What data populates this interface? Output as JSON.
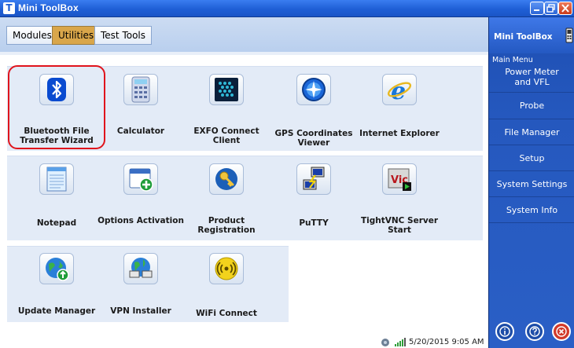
{
  "window": {
    "title": "Mini ToolBox",
    "logo_letter": "T"
  },
  "tabs": [
    {
      "label": "Modules",
      "active": false
    },
    {
      "label": "Utilities",
      "active": true
    },
    {
      "label": "Test Tools",
      "active": false
    }
  ],
  "apps": {
    "row1": [
      {
        "label": "Bluetooth File Transfer Wizard",
        "icon": "bluetooth-icon",
        "selected": true
      },
      {
        "label": "Calculator",
        "icon": "calculator-icon"
      },
      {
        "label": "EXFO Connect Client",
        "icon": "exfo-connect-icon"
      },
      {
        "label": "GPS Coordinates Viewer",
        "icon": "gps-compass-icon"
      },
      {
        "label": "Internet Explorer",
        "icon": "internet-explorer-icon"
      }
    ],
    "row2": [
      {
        "label": "Notepad",
        "icon": "notepad-icon"
      },
      {
        "label": "Options Activation",
        "icon": "options-activation-icon"
      },
      {
        "label": "Product Registration",
        "icon": "key-icon"
      },
      {
        "label": "PuTTY",
        "icon": "putty-icon"
      },
      {
        "label": "TightVNC Server Start",
        "icon": "tightvnc-icon"
      }
    ],
    "row3": [
      {
        "label": "Update Manager",
        "icon": "globe-update-icon"
      },
      {
        "label": "VPN Installer",
        "icon": "vpn-globe-icon"
      },
      {
        "label": "WiFi Connect",
        "icon": "wifi-icon"
      }
    ]
  },
  "app_labels": {
    "bluetooth_l1": "Bluetooth File",
    "bluetooth_l2": "Transfer Wizard",
    "calculator": "Calculator",
    "exfo": "EXFO Connect Client",
    "gps_l1": "GPS Coordinates",
    "gps_l2": "Viewer",
    "ie": "Internet Explorer",
    "notepad": "Notepad",
    "options": "Options Activation",
    "product_l1": "Product",
    "product_l2": "Registration",
    "putty": "PuTTY",
    "tightvnc_l1": "TightVNC Server",
    "tightvnc_l2": "Start",
    "update": "Update Manager",
    "vpn": "VPN Installer",
    "wifi": "WiFi Connect"
  },
  "right_panel": {
    "title": "Mini ToolBox",
    "section": "Main Menu",
    "items": [
      {
        "l1": "Power Meter",
        "l2": "and VFL"
      },
      {
        "l1": "Probe"
      },
      {
        "l1": "File Manager"
      },
      {
        "l1": "Setup"
      },
      {
        "l1": "System Settings"
      },
      {
        "l1": "System Info"
      }
    ],
    "bottom_buttons": [
      "info-icon",
      "help-icon",
      "close-icon"
    ]
  },
  "status": {
    "datetime": "5/20/2015 9:05 AM"
  },
  "colors": {
    "titlebar": "#1f5fd6",
    "active_tab": "#d9a64a",
    "panel": "#2558be",
    "selection": "#e0141c"
  }
}
